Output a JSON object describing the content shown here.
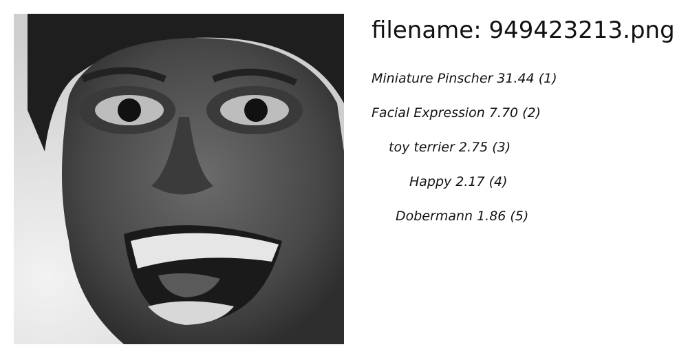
{
  "header": {
    "filename_prefix": "filename: ",
    "filename_value": "949423213.png"
  },
  "image": {
    "subject": "grayscale close-up of a laughing face",
    "icon": "photo"
  },
  "predictions": [
    {
      "label": "Miniature Pinscher",
      "score": "31.44",
      "rank": "(1)"
    },
    {
      "label": "Facial Expression",
      "score": "7.70",
      "rank": "(2)"
    },
    {
      "label": "toy terrier",
      "score": "2.75",
      "rank": "(3)"
    },
    {
      "label": "Happy",
      "score": "2.17",
      "rank": "(4)"
    },
    {
      "label": "Dobermann",
      "score": "1.86",
      "rank": "(5)"
    }
  ]
}
